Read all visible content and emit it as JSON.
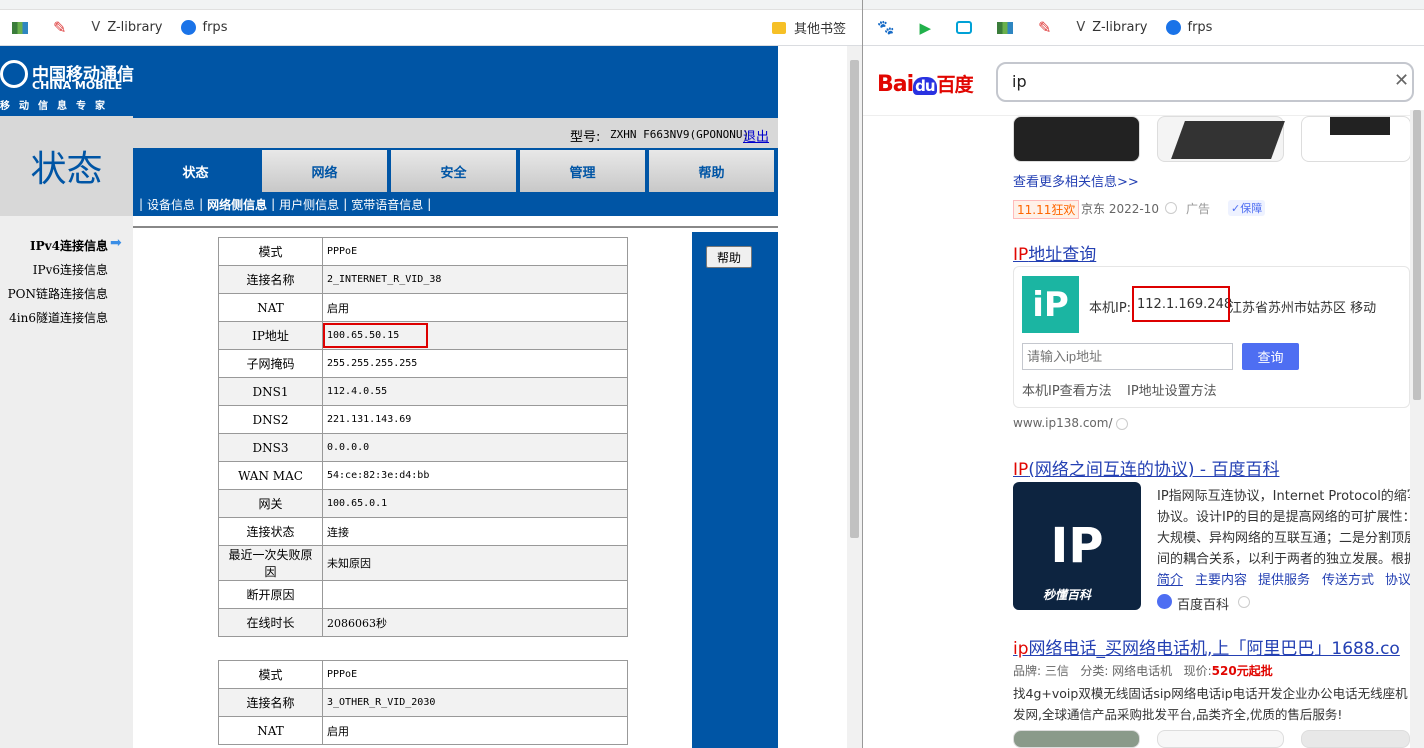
{
  "left_browser": {
    "bookmarks": [
      {
        "icon": "map-icon",
        "label": ""
      },
      {
        "icon": "feather-icon",
        "label": ""
      },
      {
        "icon": "z-library-icon",
        "label": "Z-library"
      },
      {
        "icon": "frps-icon",
        "label": "frps"
      }
    ],
    "other_bookmarks": "其他书签"
  },
  "router": {
    "brand_cn": "中国移动通信",
    "brand_en": "CHINA MOBILE",
    "brand_slogan": "移动信息专家",
    "section_title": "状态",
    "model_label": "型号:",
    "model_value": "ZXHN F663NV9(GPONONU)",
    "logout": "退出",
    "tabs": [
      "状态",
      "网络",
      "安全",
      "管理",
      "帮助"
    ],
    "subnav": [
      "设备信息",
      "网络侧信息",
      "用户侧信息",
      "宽带语音信息"
    ],
    "side_items": [
      "IPv4连接信息",
      "IPv6连接信息",
      "PON链路连接信息",
      "4in6隧道连接信息"
    ],
    "help_button": "帮助",
    "table1": [
      {
        "k": "模式",
        "v": "PPPoE"
      },
      {
        "k": "连接名称",
        "v": "2_INTERNET_R_VID_38"
      },
      {
        "k": "NAT",
        "v": "启用"
      },
      {
        "k": "IP地址",
        "v": "100.65.50.15"
      },
      {
        "k": "子网掩码",
        "v": "255.255.255.255"
      },
      {
        "k": "DNS1",
        "v": "112.4.0.55"
      },
      {
        "k": "DNS2",
        "v": "221.131.143.69"
      },
      {
        "k": "DNS3",
        "v": "0.0.0.0"
      },
      {
        "k": "WAN MAC",
        "v": "54:ce:82:3e:d4:bb"
      },
      {
        "k": "网关",
        "v": "100.65.0.1"
      },
      {
        "k": "连接状态",
        "v": "连接"
      },
      {
        "k": "最近一次失败原因",
        "v": "未知原因"
      },
      {
        "k": "断开原因",
        "v": ""
      },
      {
        "k": "在线时长",
        "v": "2086063秒"
      }
    ],
    "table2": [
      {
        "k": "模式",
        "v": "PPPoE"
      },
      {
        "k": "连接名称",
        "v": "3_OTHER_R_VID_2030"
      },
      {
        "k": "NAT",
        "v": "启用"
      }
    ]
  },
  "right_browser": {
    "bookmarks": [
      {
        "icon": "baidu-paw-icon",
        "label": ""
      },
      {
        "icon": "play-icon",
        "label": ""
      },
      {
        "icon": "bilibili-icon",
        "label": ""
      },
      {
        "icon": "map-icon",
        "label": ""
      },
      {
        "icon": "feather-icon",
        "label": ""
      },
      {
        "icon": "z-library-icon",
        "label": "Z-library"
      },
      {
        "icon": "frps-icon",
        "label": "frps"
      }
    ],
    "search_query": "ip",
    "logo_bai": "Bai",
    "logo_du": "du",
    "logo_cn": "百度",
    "more_link": "查看更多相关信息>>",
    "ad_badge": "11.11狂欢",
    "ad_source": "京东 2022-10",
    "ad_label": "广告",
    "ad_guarantee": "保障",
    "r1_title_red": "IP",
    "r1_title_rest": "地址查询",
    "r1_ip_label": "本机IP:",
    "r1_ip_value": "112.1.169.248",
    "r1_ip_loc": "江苏省苏州市姑苏区 移动",
    "r1_input_placeholder": "请输入ip地址",
    "r1_query_btn": "查询",
    "r1_link1": "本机IP查看方法",
    "r1_link2": "IP地址设置方法",
    "r1_url": "www.ip138.com/",
    "r2_title_red": "IP",
    "r2_title_rest": "(网络之间互连的协议) - 百度百科",
    "r2_lines": [
      "IP指网际互连协议，Internet Protocol的缩写,",
      "协议。设计IP的目的是提高网络的可扩展性：",
      "大规模、异构网络的互联互通；二是分割顶层",
      "间的耦合关系，以利于两者的独立发展。根据"
    ],
    "r2_links": [
      "简介",
      "主要内容",
      "提供服务",
      "传送方式",
      "协议"
    ],
    "r2_source": "百度百科",
    "r2_img_caption": "秒懂百科",
    "r3_title_red": "ip",
    "r3_title_rest": "网络电话_买网络电话机,上「阿里巴巴」1688.co",
    "r3_meta_brand": "品牌: 三信",
    "r3_meta_cat": "分类: 网络电话机",
    "r3_meta_price_label": "现价:",
    "r3_meta_price": "520元起批",
    "r3_line1": "找4g+voip双模无线固话sip网络电话ip电话开发企业办公电话无线座机",
    "r3_line2": "发网,全球通信产品采购批发平台,品类齐全,优质的售后服务!"
  }
}
